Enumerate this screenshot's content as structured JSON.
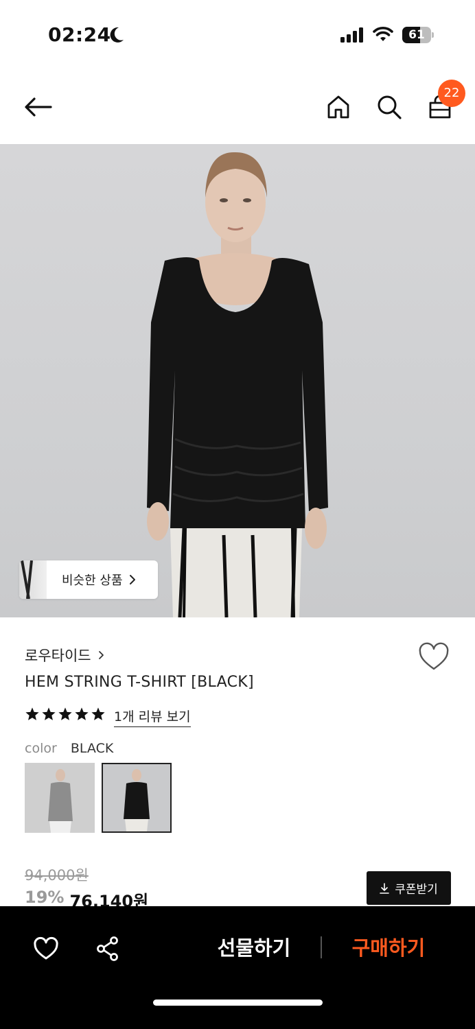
{
  "status_bar": {
    "time": "02:24",
    "battery_level": "61",
    "battery_fraction": 0.61
  },
  "header": {
    "cart_count": "22",
    "icons": [
      "back-arrow-icon",
      "home-icon",
      "search-icon",
      "shopping-bag-icon"
    ]
  },
  "hero": {
    "similar_label": "비슷한 상품"
  },
  "product": {
    "brand": "로우타이드",
    "title": "HEM STRING T-SHIRT [BLACK]",
    "rating_stars": 5,
    "review_link": "1개 리뷰 보기",
    "color_label": "color",
    "color_value": "BLACK",
    "original_price": "94,000원",
    "discount": "19%",
    "sale_price": "76,140원",
    "coupon_label": "쿠폰받기"
  },
  "bottom_bar": {
    "gift_label": "선물하기",
    "buy_label": "구매하기"
  },
  "colors": {
    "accent": "#ff5a1f",
    "bottom_bar_bg": "#000000",
    "hero_bg": "#d3d4d6"
  }
}
